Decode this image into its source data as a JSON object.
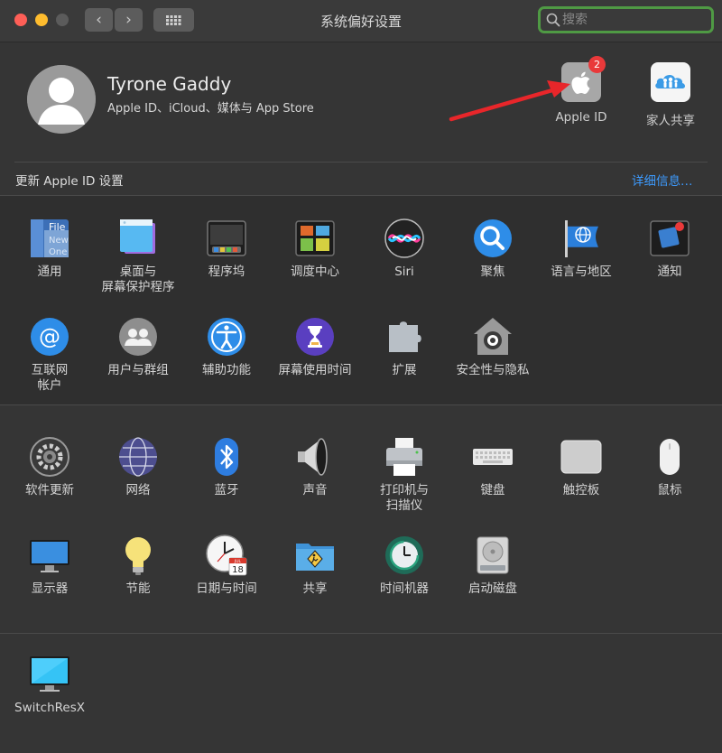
{
  "window": {
    "title": "系统偏好设置",
    "nav": {
      "back": "‹",
      "forward": "›",
      "grid": "grid-icon"
    },
    "search": {
      "placeholder": "搜索",
      "value": ""
    }
  },
  "user": {
    "name": "Tyrone Gaddy",
    "subtitle": "Apple ID、iCloud、媒体与 App Store"
  },
  "top_icons": [
    {
      "label": "Apple ID",
      "badge": "2",
      "icon": "apple-icon"
    },
    {
      "label": "家人共享",
      "icon": "family-icon"
    }
  ],
  "update_bar": {
    "text": "更新 Apple ID 设置",
    "link": "详细信息…"
  },
  "section1": [
    {
      "label": "通用",
      "icon": "general-icon"
    },
    {
      "label": "桌面与",
      "label2": "屏幕保护程序",
      "icon": "desktop-icon"
    },
    {
      "label": "程序坞",
      "icon": "dock-icon"
    },
    {
      "label": "调度中心",
      "icon": "mission-control-icon"
    },
    {
      "label": "Siri",
      "icon": "siri-icon"
    },
    {
      "label": "聚焦",
      "icon": "spotlight-icon"
    },
    {
      "label": "语言与地区",
      "icon": "flag-icon"
    },
    {
      "label": "通知",
      "icon": "notification-icon"
    },
    {
      "label": "互联网",
      "label2": "帐户",
      "icon": "at-icon"
    },
    {
      "label": "用户与群组",
      "icon": "users-icon"
    },
    {
      "label": "辅助功能",
      "icon": "accessibility-icon"
    },
    {
      "label": "屏幕使用时间",
      "icon": "hourglass-icon"
    },
    {
      "label": "扩展",
      "icon": "puzzle-icon"
    },
    {
      "label": "安全性与隐私",
      "icon": "house-lock-icon"
    }
  ],
  "section2": [
    {
      "label": "软件更新",
      "icon": "gear-icon"
    },
    {
      "label": "网络",
      "icon": "globe-icon"
    },
    {
      "label": "蓝牙",
      "icon": "bluetooth-icon"
    },
    {
      "label": "声音",
      "icon": "speaker-icon"
    },
    {
      "label": "打印机与",
      "label2": "扫描仪",
      "icon": "printer-icon"
    },
    {
      "label": "键盘",
      "icon": "keyboard-icon"
    },
    {
      "label": "触控板",
      "icon": "trackpad-icon"
    },
    {
      "label": "鼠标",
      "icon": "mouse-icon"
    },
    {
      "label": "显示器",
      "icon": "display-icon"
    },
    {
      "label": "节能",
      "icon": "bulb-icon"
    },
    {
      "label": "日期与时间",
      "icon": "clock-icon",
      "calendar_month": "JUL",
      "calendar_day": "18"
    },
    {
      "label": "共享",
      "icon": "sharing-folder-icon"
    },
    {
      "label": "时间机器",
      "icon": "time-machine-icon"
    },
    {
      "label": "启动磁盘",
      "icon": "disk-icon"
    }
  ],
  "section3": [
    {
      "label": "SwitchResX",
      "icon": "monitor-icon"
    }
  ],
  "colors": {
    "accent_link": "#3d9bff",
    "badge": "#e9393a",
    "arrow": "#e8262a",
    "search_focus": "#4f9a44"
  }
}
